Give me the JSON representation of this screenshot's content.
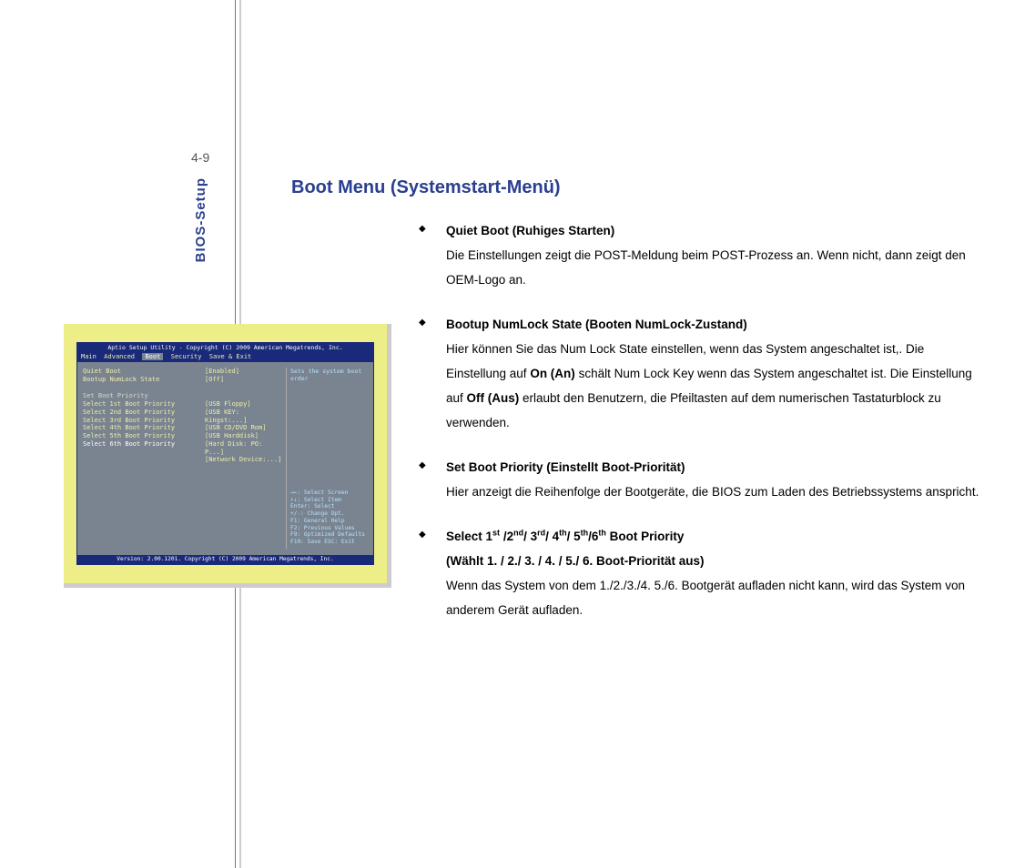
{
  "page_number": "4-9",
  "section_label": "BIOS-Setup",
  "heading": "Boot Menu (Systemstart-Menü)",
  "items": [
    {
      "title": "Quiet Boot (Ruhiges Starten)",
      "text": "Die Einstellungen zeigt die POST-Meldung beim POST-Prozess an. Wenn nicht, dann zeigt den OEM-Logo an."
    },
    {
      "title": "Bootup NumLock State (Booten NumLock-Zustand)",
      "text_before": "Hier können Sie das Num Lock State einstellen, wenn das System angeschaltet ist,. Die Einstellung auf ",
      "bold1": "On (An)",
      "text_mid": " schält Num Lock Key wenn das System angeschaltet ist. Die Einstellung auf ",
      "bold2": "Off (Aus)",
      "text_after": " erlaubt den Benutzern, die Pfeiltasten auf dem numerischen Tastaturblock zu verwenden."
    },
    {
      "title": "Set Boot Priority (Einstellt Boot-Priorität)",
      "text": "Hier anzeigt die Reihenfolge der Bootgeräte, die BIOS zum Laden des Betriebssystems anspricht."
    },
    {
      "title_parts": {
        "p0": "Select 1",
        "s0": "st",
        "p1": " /2",
        "s1": "nd",
        "p2": "/ 3",
        "s2": "rd",
        "p3": "/ 4",
        "s3": "th",
        "p4": "/ 5",
        "s4": "th",
        "p5": "/6",
        "s5": "th",
        "p6": " Boot Priority"
      },
      "subtitle": "(Wählt 1. / 2./ 3. / 4. / 5./ 6. Boot-Priorität aus)",
      "text": "Wenn das System von dem 1./2./3./4. 5./6. Bootgerät aufladen nicht kann, wird das System von anderem Gerät aufladen."
    }
  ],
  "bios": {
    "title": "Aptio Setup Utility - Copyright (C) 2009 American Megatrends, Inc.",
    "menu": {
      "m0": "Main",
      "m1": "Advanced",
      "m2": "Boot",
      "m3": "Security",
      "m4": "Save & Exit"
    },
    "left": {
      "r0": "Quiet Boot",
      "r1": "Bootup NumLock State",
      "r2": "Set Boot Priority",
      "r3": "Select 1st Boot Priority",
      "r4": "Select 2nd Boot Priority",
      "r5": "Select 3rd Boot Priority",
      "r6": "Select 4th Boot Priority",
      "r7": "Select 5th Boot Priority",
      "r8": "Select 6th Boot Priority"
    },
    "vals": {
      "v0": "[Enabled]",
      "v1": "[Off]",
      "v3": "[USB Floppy]",
      "v4": "[USB KEY: Kingst:...]",
      "v5": "[USB CD/DVD Rom]",
      "v6": "[USB Harddisk]",
      "v7": "[Hard Disk: PO: P...]",
      "v8": "[Network Device:...]"
    },
    "help_text": "Sets the system boot order",
    "hints": {
      "h0": "→←: Select Screen",
      "h1": "↑↓: Select Item",
      "h2": "Enter: Select",
      "h3": "+/-: Change Opt.",
      "h4": "F1: General Help",
      "h5": "F2: Previous Values",
      "h6": "F9: Optimized Defaults",
      "h7": "F10: Save  ESC: Exit"
    },
    "footer": "Version: 2.00.1201. Copyright (C) 2009 American Megatrends, Inc."
  }
}
